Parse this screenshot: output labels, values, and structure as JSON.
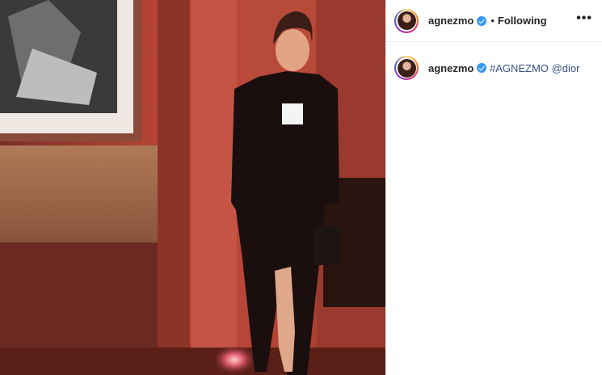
{
  "post": {
    "username": "agnezmo",
    "verified": true,
    "follow_separator": "•",
    "follow_status": "Following",
    "more_icon": "•••",
    "caption": {
      "username": "agnezmo",
      "hashtag": "#AGNEZMO",
      "mention": "@dior"
    }
  },
  "colors": {
    "link": "#385185",
    "verified_badge": "#3897f0"
  }
}
